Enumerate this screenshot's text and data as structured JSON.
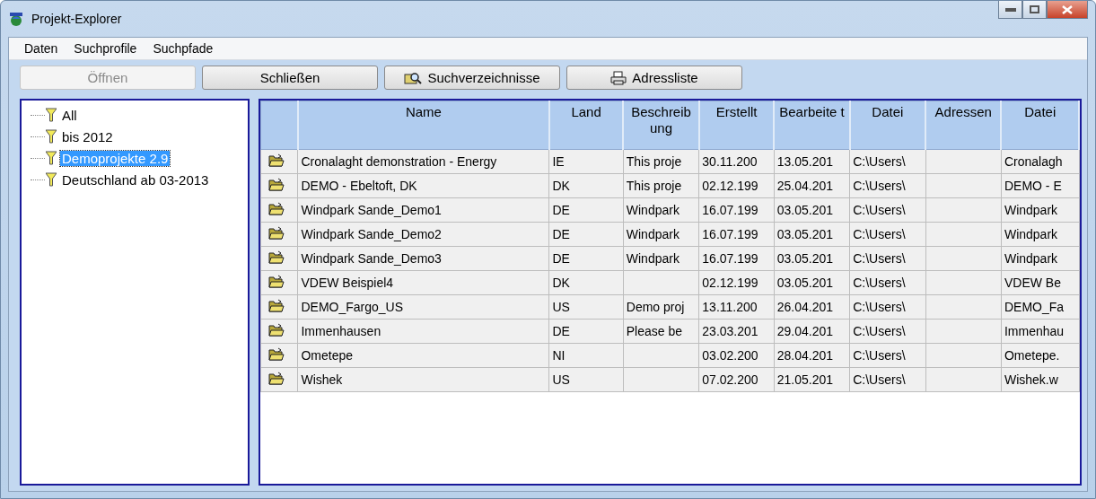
{
  "window": {
    "title": "Projekt-Explorer"
  },
  "menu": [
    "Daten",
    "Suchprofile",
    "Suchpfade"
  ],
  "toolbar": [
    {
      "label": "Öffnen",
      "disabled": true,
      "kind": "plain"
    },
    {
      "label": "Schließen",
      "disabled": false,
      "kind": "plain"
    },
    {
      "label": "Suchverzeichnisse",
      "disabled": false,
      "kind": "search"
    },
    {
      "label": "Adressliste",
      "disabled": false,
      "kind": "print"
    }
  ],
  "tree": [
    {
      "label": "All",
      "selected": false
    },
    {
      "label": "bis 2012",
      "selected": false
    },
    {
      "label": "Demoprojekte 2.9",
      "selected": true
    },
    {
      "label": "Deutschland ab 03-2013",
      "selected": false
    }
  ],
  "table": {
    "columns": [
      "Name",
      "Land",
      "Beschreib ung",
      "Erstellt",
      "Bearbeite t",
      "Datei",
      "Adressen",
      "Datei"
    ],
    "rows": [
      [
        "Cronalaght demonstration - Energy",
        "IE",
        "This proje",
        "30.11.200",
        "13.05.201",
        "C:\\Users\\",
        "",
        "Cronalagh"
      ],
      [
        "DEMO - Ebeltoft, DK",
        "DK",
        "This proje",
        "02.12.199",
        "25.04.201",
        "C:\\Users\\",
        "",
        "DEMO - E"
      ],
      [
        "Windpark Sande_Demo1",
        "DE",
        "Windpark",
        "16.07.199",
        "03.05.201",
        "C:\\Users\\",
        "",
        "Windpark"
      ],
      [
        "Windpark Sande_Demo2",
        "DE",
        "Windpark",
        "16.07.199",
        "03.05.201",
        "C:\\Users\\",
        "",
        "Windpark"
      ],
      [
        "Windpark Sande_Demo3",
        "DE",
        "Windpark",
        "16.07.199",
        "03.05.201",
        "C:\\Users\\",
        "",
        "Windpark"
      ],
      [
        "VDEW Beispiel4",
        "DK",
        "",
        "02.12.199",
        "03.05.201",
        "C:\\Users\\",
        "",
        "VDEW Be"
      ],
      [
        "DEMO_Fargo_US",
        "US",
        "Demo proj",
        "13.11.200",
        "26.04.201",
        "C:\\Users\\",
        "",
        "DEMO_Fa"
      ],
      [
        "Immenhausen",
        "DE",
        "Please be",
        "23.03.201",
        "29.04.201",
        "C:\\Users\\",
        "",
        "Immenhau"
      ],
      [
        "Ometepe",
        "NI",
        "",
        "03.02.200",
        "28.04.201",
        "C:\\Users\\",
        "",
        "Ometepe."
      ],
      [
        "Wishek",
        "US",
        "",
        "07.02.200",
        "21.05.201",
        "C:\\Users\\",
        "",
        "Wishek.w"
      ]
    ]
  }
}
